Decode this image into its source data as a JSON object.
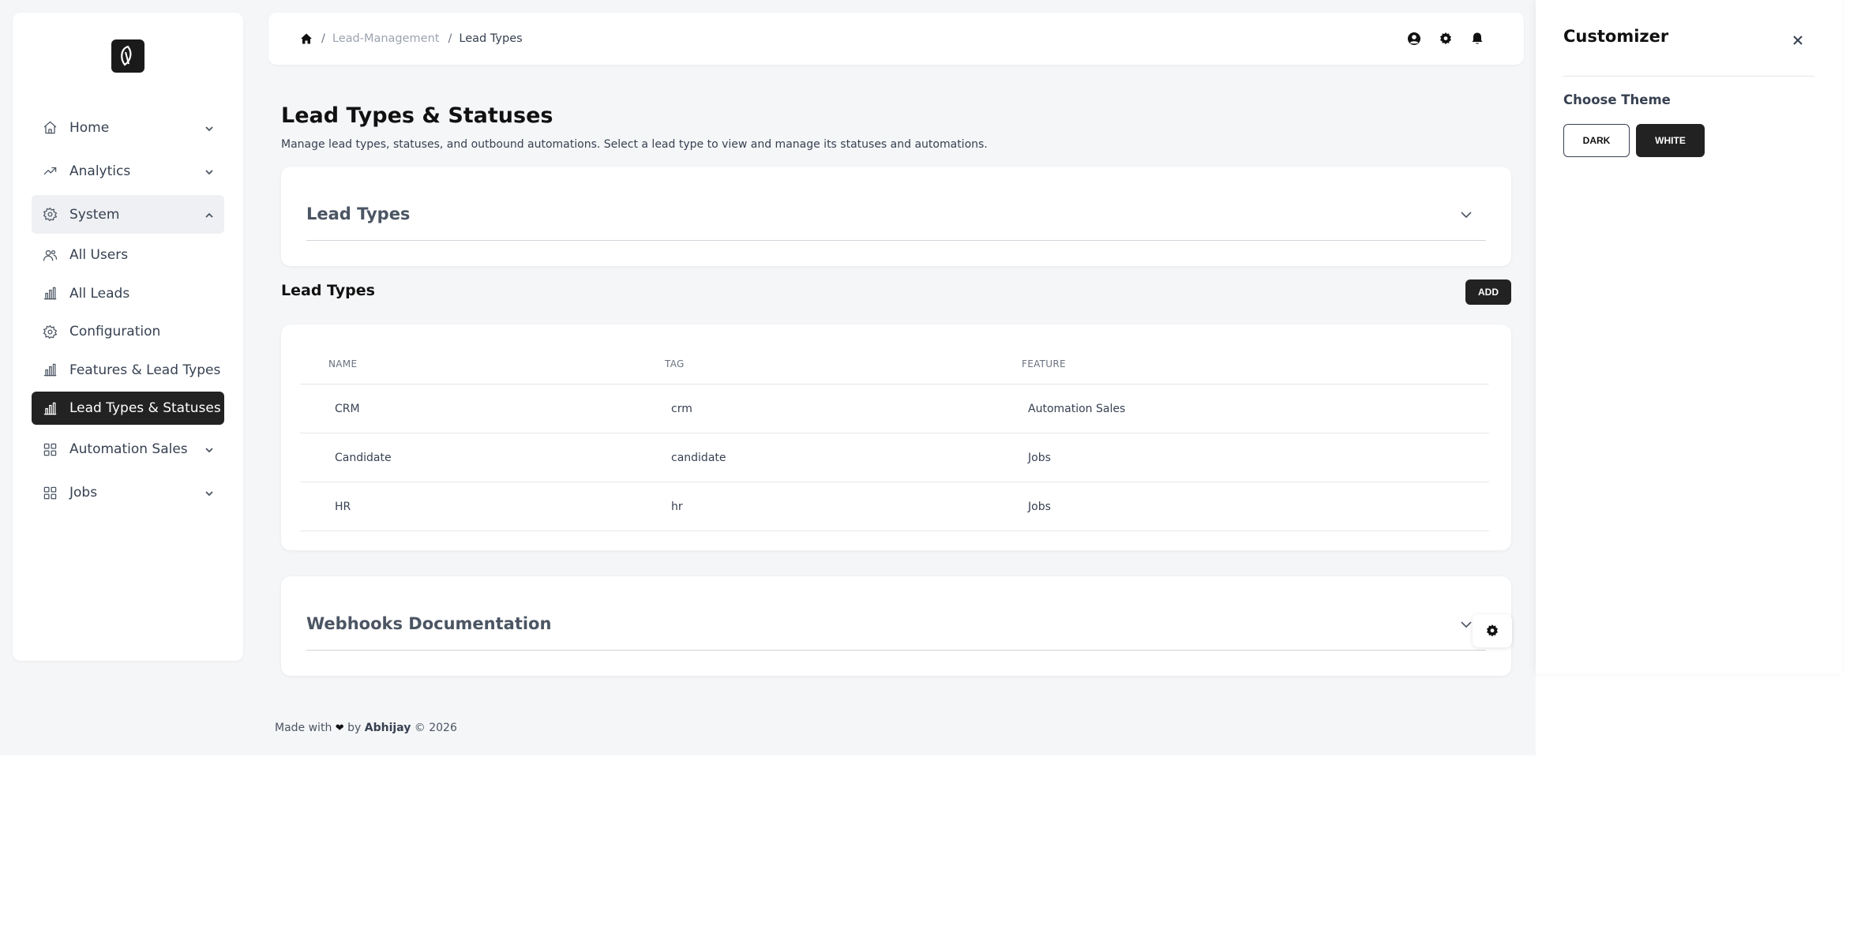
{
  "sidebar": {
    "items": [
      {
        "label": "Home",
        "icon": "home-icon"
      },
      {
        "label": "Analytics",
        "icon": "trend-icon"
      },
      {
        "label": "System",
        "icon": "gear-icon"
      },
      {
        "label": "All Users",
        "icon": "users-icon"
      },
      {
        "label": "All Leads",
        "icon": "bar-chart-icon"
      },
      {
        "label": "Configuration",
        "icon": "gear-icon"
      },
      {
        "label": "Features & Lead Types",
        "icon": "bar-chart-icon"
      },
      {
        "label": "Lead Types & Statuses",
        "icon": "bar-chart-icon"
      },
      {
        "label": "Automation Sales",
        "icon": "grid-icon"
      },
      {
        "label": "Jobs",
        "icon": "grid-icon"
      }
    ]
  },
  "breadcrumb": {
    "separator": "/",
    "items": [
      "Lead-Management",
      "Lead Types"
    ]
  },
  "page": {
    "title": "Lead Types & Statuses",
    "description": "Manage lead types, statuses, and outbound automations. Select a lead type to view and manage its statuses and automations."
  },
  "accordion_lead_types": {
    "title": "Lead Types"
  },
  "lead_types_section": {
    "title": "Lead Types",
    "add_label": "ADD"
  },
  "table": {
    "columns": [
      "NAME",
      "TAG",
      "FEATURE"
    ],
    "rows": [
      [
        "CRM",
        "crm",
        "Automation Sales"
      ],
      [
        "Candidate",
        "candidate",
        "Jobs"
      ],
      [
        "HR",
        "hr",
        "Jobs"
      ]
    ]
  },
  "accordion_webhooks": {
    "title": "Webhooks Documentation"
  },
  "footer": {
    "made_with": "Made with",
    "by": "by",
    "author": "Abhijay",
    "copyright": "© 2026"
  },
  "customizer": {
    "title": "Customizer",
    "theme_label": "Choose Theme",
    "dark_label": "DARK",
    "white_label": "WHITE",
    "selected_theme": "WHITE"
  },
  "colors": {
    "accent": "#222222",
    "background": "#f5f6f8"
  }
}
